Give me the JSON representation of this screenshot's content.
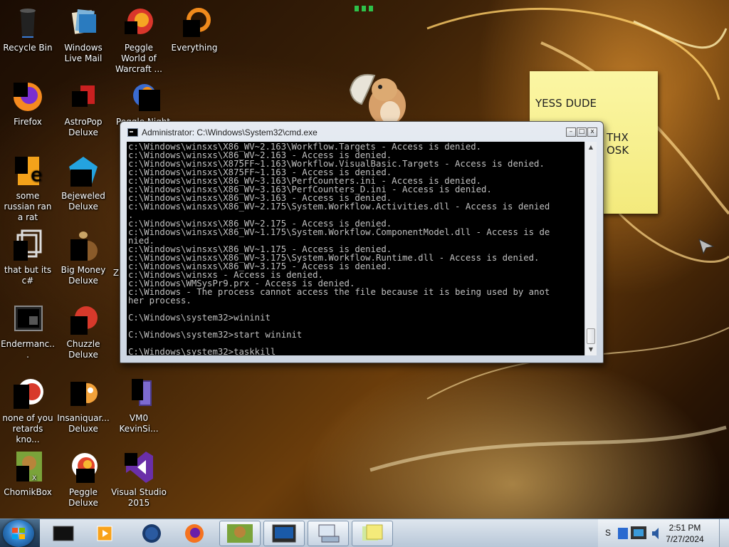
{
  "desktop": {
    "icons": [
      {
        "label": "Recycle Bin",
        "icon": "recycle-bin-icon"
      },
      {
        "label": "Windows Live Mail",
        "icon": "windows-live-mail-icon"
      },
      {
        "label": "Peggle World of Warcraft ...",
        "icon": "peggle-wow-icon"
      },
      {
        "label": "Everything",
        "icon": "everything-search-icon"
      },
      {
        "label": "Firefox",
        "icon": "firefox-icon"
      },
      {
        "label": "AstroPop Deluxe",
        "icon": "astropop-icon"
      },
      {
        "label": "some russian ran a rat",
        "icon": "shortcut-e-icon"
      },
      {
        "label": "Bejeweled Deluxe",
        "icon": "bejeweled-icon"
      },
      {
        "label": "that but its c#",
        "icon": "shortcut-window-icon"
      },
      {
        "label": "Big Money Deluxe",
        "icon": "big-money-icon"
      },
      {
        "label": "Endermanc...",
        "icon": "enderman-icon"
      },
      {
        "label": "Chuzzle Deluxe",
        "icon": "chuzzle-icon"
      },
      {
        "label": "none of you retards kno...",
        "icon": "peggle-shortcut-icon"
      },
      {
        "label": "Insaniquar... Deluxe",
        "icon": "insaniquarium-icon"
      },
      {
        "label": "VM0 KevinSi...",
        "icon": "vm-icon"
      },
      {
        "label": "ChomikBox",
        "icon": "chomikbox-icon"
      },
      {
        "label": "Peggle Deluxe",
        "icon": "peggle-icon"
      },
      {
        "label": "Visual Studio 2015",
        "icon": "visual-studio-icon"
      }
    ],
    "partial_labels": {
      "peggle_nights": "Peggle Night",
      "z_label": "Z"
    }
  },
  "sticky_note": {
    "line1": "YESS DUDE",
    "line3": "THX OSK"
  },
  "cmd_window": {
    "title": "Administrator: C:\\Windows\\System32\\cmd.exe",
    "minimize": "–",
    "maximize": "□",
    "close": "x",
    "lines": [
      "c:\\Windows\\winsxs\\X86_WV~2.163\\Workflow.Targets - Access is denied.",
      "c:\\Windows\\winsxs\\X86_WV~2.163 - Access is denied.",
      "c:\\Windows\\winsxs\\X875FF~1.163\\Workflow.VisualBasic.Targets - Access is denied.",
      "c:\\Windows\\winsxs\\X875FF~1.163 - Access is denied.",
      "c:\\Windows\\winsxs\\X86_WV~3.163\\PerfCounters.ini - Access is denied.",
      "c:\\Windows\\winsxs\\X86_WV~3.163\\PerfCounters_D.ini - Access is denied.",
      "c:\\Windows\\winsxs\\X86_WV~3.163 - Access is denied.",
      "c:\\Windows\\winsxs\\X86_WV~2.175\\System.Workflow.Activities.dll - Access is denied",
      ".",
      "c:\\Windows\\winsxs\\X86_WV~2.175 - Access is denied.",
      "c:\\Windows\\winsxs\\X86_WV~1.175\\System.Workflow.ComponentModel.dll - Access is de",
      "nied.",
      "c:\\Windows\\winsxs\\X86_WV~1.175 - Access is denied.",
      "c:\\Windows\\winsxs\\X86_WV~3.175\\System.Workflow.Runtime.dll - Access is denied.",
      "c:\\Windows\\winsxs\\X86_WV~3.175 - Access is denied.",
      "c:\\Windows\\winsxs - Access is denied.",
      "c:\\Windows\\WMSysPr9.prx - Access is denied.",
      "c:\\Windows - The process cannot access the file because it is being used by anot",
      "her process.",
      "",
      "C:\\Windows\\system32>wininit",
      "",
      "C:\\Windows\\system32>start wininit",
      "",
      "C:\\Windows\\system32>taskkill"
    ]
  },
  "taskbar": {
    "start_icon": "windows-orb-icon",
    "buttons": [
      {
        "icon": "cmd-icon"
      },
      {
        "icon": "media-player-icon"
      },
      {
        "icon": "globe-icon"
      },
      {
        "icon": "firefox-icon"
      },
      {
        "icon": "chomikbox-icon"
      },
      {
        "icon": "cmd-window-icon"
      },
      {
        "icon": "computer-icon"
      },
      {
        "icon": "sticky-notes-icon"
      }
    ],
    "tray_partial": "S",
    "clock_time": "2:51 PM",
    "clock_date": "7/27/2024"
  }
}
